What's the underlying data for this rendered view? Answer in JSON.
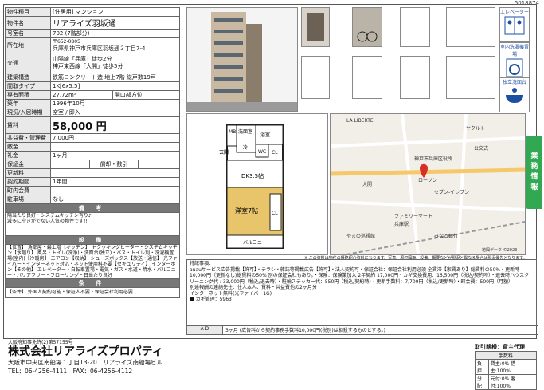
{
  "sheet_id": "5018874",
  "property": {
    "rows": [
      {
        "key": "物件種目",
        "value": "[住居用] マンション"
      },
      {
        "key": "物件名",
        "value": "リアライズ羽坂通"
      },
      {
        "key": "号室名",
        "value": "702 (7階部分)"
      },
      {
        "key": "所在地",
        "postal": "〒652-0805",
        "value": "兵庫県神戸市兵庫区羽坂通３丁目7-4"
      },
      {
        "key": "交通",
        "line1": "山陽線「兵庫」徒歩2分",
        "line2": "神戸東西線「大開」徒歩5分"
      },
      {
        "key": "建築構造",
        "value": "鉄筋コンクリート造 地上7階 総戸数19戸"
      },
      {
        "key": "間取タイプ",
        "value": "1K[6x5.5]"
      },
      {
        "key": "専有面積",
        "value": "27.72m²",
        "extra_key": "開口部方位",
        "extra_value": ""
      },
      {
        "key": "築年",
        "value": "1996年10月"
      },
      {
        "key": "現況/入居時期",
        "value": "空室 / 即入"
      },
      {
        "key": "賃料",
        "value": "58,000 円"
      },
      {
        "key": "共益費・管理費",
        "value": "7,000円"
      },
      {
        "key": "敷金",
        "value": ""
      },
      {
        "key": "礼金",
        "value": "1ヶ月"
      },
      {
        "key": "保証金",
        "value": "",
        "extra_key": "償却・敷引",
        "extra_value": ""
      },
      {
        "key": "更新料",
        "value": ""
      },
      {
        "key": "契約期間",
        "value": "1年間"
      },
      {
        "key": "町内会費",
        "value": ""
      },
      {
        "key": "駐車場",
        "value": "なし"
      }
    ],
    "remarks_title": "備 考",
    "remarks": "陽当たり良好・システムキッチン有り♪\n減多に空きがでない人気の物件です!!",
    "equipment_title": "設 備",
    "equipment": "【位置】 角部屋・最上階【キッチン】 IHクッキングヒーター・システムキッチン【水廻り】 風呂・トイレ(洗浄)・洗面台(独立)・バス・トイレ別・洗濯機置場(室内)【冷暖房】 エアコン【収納】 シューズボックス【放送・通信】 光ファイバー・インターネット対応・ネット使用料不要【セキュリティ】 インターホン【その他】 エレベーター・自転車置場・電気・ガス・水道・焼水・バルコニー・バリアフリー・フローリング・日当たり良好",
    "conditions_title": "条 件",
    "conditions": "【条件】 外国人契約可能・保証人不要・保証会社利用必要"
  },
  "icons": [
    {
      "name": "elevator",
      "label": "エレベーター"
    },
    {
      "name": "washer",
      "label": "室内洗濯機置場"
    },
    {
      "name": "sink",
      "label": "独立洗面台"
    }
  ],
  "side_tab": "業務情報",
  "floorplan": {
    "rooms": [
      "MB",
      "洗面室",
      "浴室",
      "WC",
      "冷",
      "CL",
      "DK3.5帖",
      "洋室7帖",
      "CL",
      "バルコニー",
      "玄関"
    ]
  },
  "map": {
    "labels": [
      "LA LIBERTE",
      "神戸市兵庫区役所",
      "セブン-イレブン",
      "ファミリーマート",
      "大開",
      "兵庫駅",
      "みなと銀行",
      "公文式",
      "やまの巡視館",
      "ローソン",
      "ヤクルト"
    ],
    "copyright": "地図データ ©2023"
  },
  "photo_note": "※ この資料は物件の概略紹介資料になります。写真、周辺図面、設備、概要などが現況と異なる場合は現況優先となります。",
  "notes_title": "特記事項：",
  "notes": "auauサービス広告掲載【許可】・テラシ・雑誌等掲載広告【許可】・法人契約可・保証会社：保証会社利用必須 全賃滞【家賃あり】総賃料の50%・更新時10,000円（更新なし)総賃料の50% 別の保証会社もあり。・保険：保険業加入 2年契約 17,000円・カギ交換費用：16,500円（税込/契約時）・退去時ハウスクリーニング代 : 33,000円（税込/退去時）・駐輪ステッカー代：550円（税込/契約時）・更新手数料：7,700円（税込/更新時）・町会費：500円（月額）\n別途報酬の連絡先住：住人本人、賃料・共益費他の2ヶ月分\nインターネット無料(光ファイバー1G)\n■ カギ管理：5963",
  "ad": {
    "key": "A D",
    "value": "3ヶ月 (広告料から契約事務手数料10,000円(税別)は相殺するものとする。)"
  },
  "company": {
    "license": "大阪府知事免許(2)第57155号",
    "name": "株式会社リアライズプロパティ",
    "address": "大阪市中央区南船場１丁目13-20　リアライズ南船場ビル",
    "tel_fax": "TEL：06-4256-4111　FAX：06-4256-4112"
  },
  "deal": {
    "type": "取引態様：貸主代理",
    "fee_title": "手数料",
    "rows": [
      {
        "k": "負担",
        "v": "貸主:0% 借主:100%"
      },
      {
        "k": "分配",
        "v": "元付:0% 客付:100%"
      }
    ]
  },
  "colors": {
    "accent_green": "#33a852",
    "icon_blue": "#1d4fa0"
  }
}
